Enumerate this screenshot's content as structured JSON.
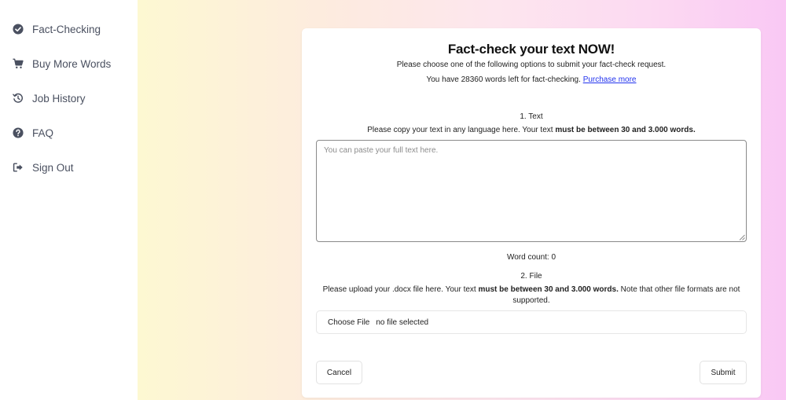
{
  "sidebar": {
    "items": [
      {
        "label": "Fact-Checking",
        "icon": "check-circle-icon"
      },
      {
        "label": "Buy More Words",
        "icon": "cart-icon"
      },
      {
        "label": "Job History",
        "icon": "history-icon"
      },
      {
        "label": "FAQ",
        "icon": "question-circle-icon"
      },
      {
        "label": "Sign Out",
        "icon": "sign-out-icon"
      }
    ]
  },
  "form": {
    "title": "Fact-check your text NOW!",
    "subtitle": "Please choose one of the following options to submit your fact-check request.",
    "words_left_prefix": "You have 28360 words left for fact-checking.",
    "purchase_link": "Purchase more",
    "text_section": {
      "heading": "1. Text",
      "desc_pre": "Please copy your text in any language here. Your text",
      "desc_bold": "must be between 30 and 3.000 words.",
      "placeholder": "You can paste your full text here.",
      "word_count": "Word count: 0"
    },
    "file_section": {
      "heading": "2. File",
      "desc_pre": "Please upload your .docx file here. Your text",
      "desc_bold": "must be between 30 and 3.000 words.",
      "desc_post": "Note that other file formats are not supported.",
      "choose_label": "Choose File",
      "file_status": "no file selected"
    },
    "cancel_label": "Cancel",
    "submit_label": "Submit"
  },
  "colors": {
    "link": "#2233ee",
    "nav_text": "#4a5060"
  }
}
